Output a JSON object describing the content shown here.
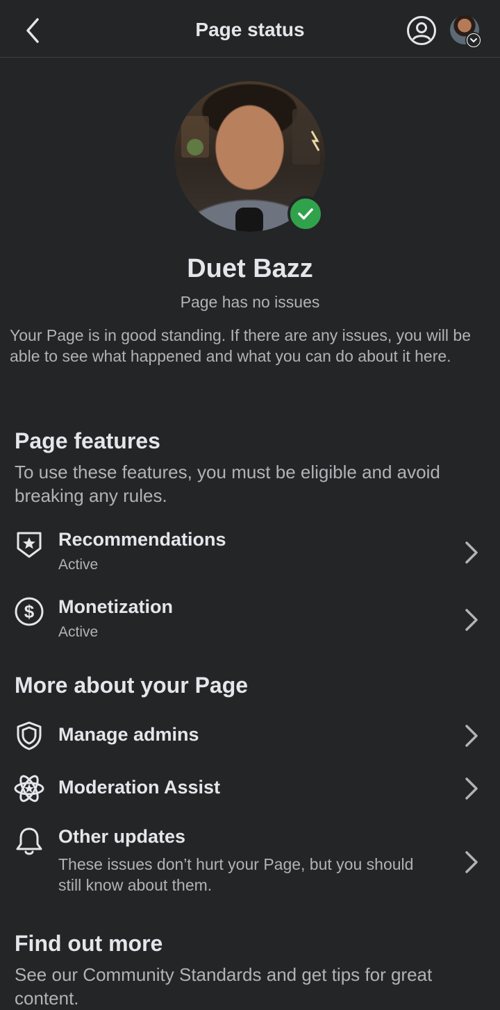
{
  "header": {
    "title": "Page status",
    "back_icon": "chevron-left-icon",
    "profile_icon": "user-circle-icon"
  },
  "profile": {
    "name": "Duet Bazz",
    "status": "Page has no issues",
    "verified_color": "#31a24c"
  },
  "description": "Your Page is in good standing. If there are any issues, you will be able to see what happened and what you can do about it here.",
  "features": {
    "heading": "Page features",
    "subtitle": "To use these features, you must be eligible and avoid breaking any rules.",
    "items": [
      {
        "label": "Recommendations",
        "status": "Active",
        "icon": "shield-star-icon"
      },
      {
        "label": "Monetization",
        "status": "Active",
        "icon": "dollar-circle-icon"
      }
    ]
  },
  "more": {
    "heading": "More about your Page",
    "items": [
      {
        "label": "Manage admins",
        "icon": "shield-icon"
      },
      {
        "label": "Moderation Assist",
        "icon": "atom-star-icon"
      },
      {
        "label": "Other updates",
        "icon": "bell-icon",
        "body": "These issues don’t hurt your Page, but you should still know about them."
      }
    ]
  },
  "find_out": {
    "heading": "Find out more",
    "subtitle": "See our Community Standards and get tips for great content."
  }
}
